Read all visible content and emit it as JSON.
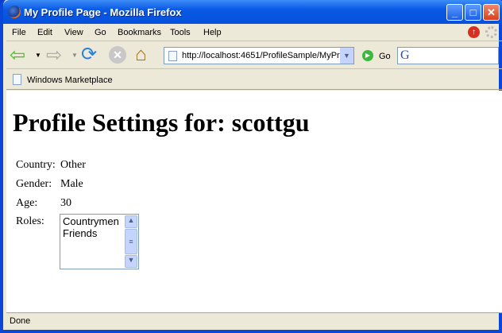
{
  "window": {
    "title": "My Profile Page - Mozilla Firefox"
  },
  "menu": [
    "File",
    "Edit",
    "View",
    "Go",
    "Bookmarks",
    "Tools",
    "Help"
  ],
  "nav": {
    "url": "http://localhost:4651/ProfileSample/MyPr",
    "go_label": "Go"
  },
  "bookmarks": [
    "Windows Marketplace"
  ],
  "page": {
    "heading": "Profile Settings for: scottgu",
    "fields": [
      {
        "label": "Country:",
        "value": "Other"
      },
      {
        "label": "Gender:",
        "value": "Male"
      },
      {
        "label": "Age:",
        "value": "30"
      }
    ],
    "roles_label": "Roles:",
    "roles": [
      "Countrymen",
      "Friends"
    ]
  },
  "status": "Done"
}
